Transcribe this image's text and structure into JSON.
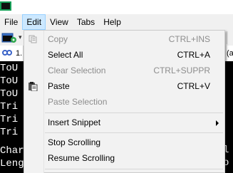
{
  "menubar": {
    "items": [
      {
        "label": "File"
      },
      {
        "label": "Edit"
      },
      {
        "label": "View"
      },
      {
        "label": "Tabs"
      },
      {
        "label": "Help"
      }
    ]
  },
  "tab": {
    "label": "1."
  },
  "right_partial": {
    "tab_text": "(a",
    "lines": [
      "l",
      "o"
    ]
  },
  "terminal": {
    "lines": [
      "ToU",
      "ToU",
      "ToU",
      "Tri",
      "Tri",
      "Tri",
      "Char",
      "Leng"
    ]
  },
  "edit_menu": {
    "items": [
      {
        "label": "Copy",
        "shortcut": "CTRL+INS",
        "enabled": false,
        "icon": "copy-icon"
      },
      {
        "label": "Select All",
        "shortcut": "CTRL+A",
        "enabled": true
      },
      {
        "label": "Clear Selection",
        "shortcut": "CTRL+SUPPR",
        "enabled": false
      },
      {
        "label": "Paste",
        "shortcut": "CTRL+V",
        "enabled": true,
        "icon": "paste-icon"
      },
      {
        "label": "Paste Selection",
        "shortcut": "",
        "enabled": false
      },
      {
        "label": "Insert Snippet",
        "shortcut": "",
        "enabled": true,
        "submenu": true
      },
      {
        "label": "Stop Scrolling",
        "shortcut": "",
        "enabled": true
      },
      {
        "label": "Resume Scrolling",
        "shortcut": "",
        "enabled": true
      }
    ]
  },
  "colors": {
    "menu_active_bg": "#cce8ff",
    "menu_bg": "#f2f2f2",
    "disabled_text": "#8d8d8d",
    "terminal_bg": "#000000",
    "terminal_fg": "#ffffff"
  }
}
